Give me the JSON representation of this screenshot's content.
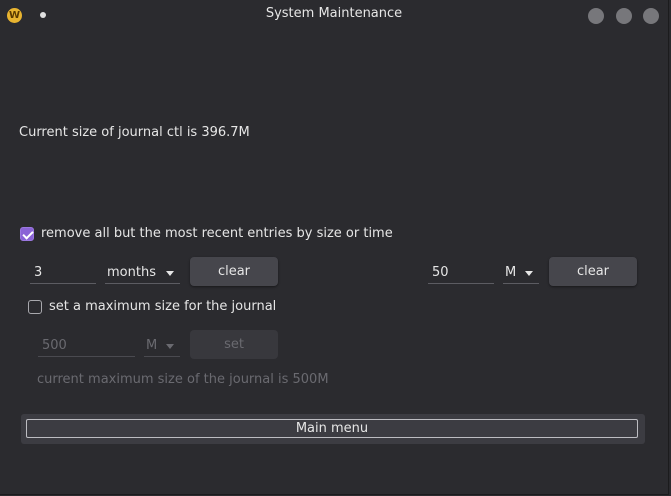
{
  "window": {
    "title": "System Maintenance",
    "app_icon_letter": "W"
  },
  "journal": {
    "current_size_text": "Current size of journal ctl is 396.7M",
    "remove_option": {
      "label": "remove all but the most recent entries by size or time",
      "checked": true
    },
    "time_value": "3",
    "time_unit": "months",
    "time_clear_label": "clear",
    "size_value": "50",
    "size_unit": "M",
    "size_clear_label": "clear",
    "max_size_option": {
      "label": "set a maximum size for the journal",
      "checked": false
    },
    "max_size_placeholder": "500",
    "max_size_unit": "M",
    "set_label": "set",
    "current_max_text": "current maximum size of the journal is 500M"
  },
  "main_menu_label": "Main menu",
  "colors": {
    "accent": "#8a63d6",
    "background": "#2b2b2f",
    "button": "#46464c"
  }
}
